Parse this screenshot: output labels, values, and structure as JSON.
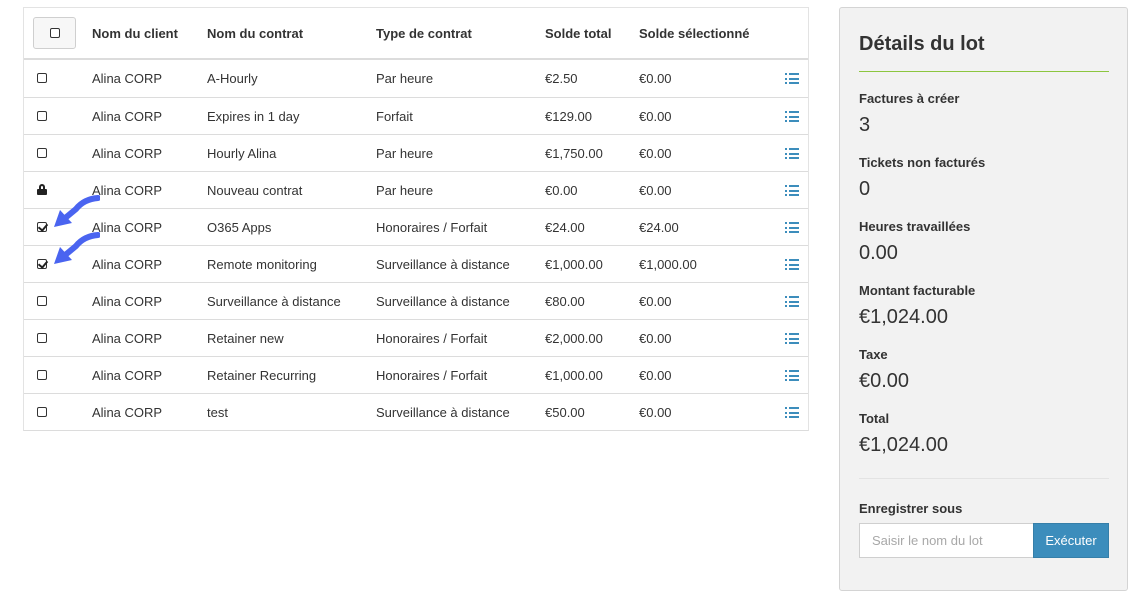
{
  "table": {
    "headers": {
      "client": "Nom du client",
      "contract": "Nom du contrat",
      "type": "Type de contrat",
      "total": "Solde total",
      "selected": "Solde sélectionné"
    },
    "rows": [
      {
        "state": "unchecked",
        "client": "Alina CORP",
        "contract": "A-Hourly",
        "type": "Par heure",
        "total": "€2.50",
        "selected": "€0.00"
      },
      {
        "state": "unchecked",
        "client": "Alina CORP",
        "contract": "Expires in 1 day",
        "type": "Forfait",
        "total": "€129.00",
        "selected": "€0.00"
      },
      {
        "state": "unchecked",
        "client": "Alina CORP",
        "contract": "Hourly Alina",
        "type": "Par heure",
        "total": "€1,750.00",
        "selected": "€0.00"
      },
      {
        "state": "locked",
        "client": "Alina CORP",
        "contract": "Nouveau contrat",
        "type": "Par heure",
        "total": "€0.00",
        "selected": "€0.00"
      },
      {
        "state": "checked",
        "client": "Alina CORP",
        "contract": "O365 Apps",
        "type": "Honoraires / Forfait",
        "total": "€24.00",
        "selected": "€24.00"
      },
      {
        "state": "checked",
        "client": "Alina CORP",
        "contract": "Remote monitoring",
        "type": "Surveillance à distance",
        "total": "€1,000.00",
        "selected": "€1,000.00"
      },
      {
        "state": "unchecked",
        "client": "Alina CORP",
        "contract": "Surveillance à distance",
        "type": "Surveillance à distance",
        "total": "€80.00",
        "selected": "€0.00"
      },
      {
        "state": "unchecked",
        "client": "Alina CORP",
        "contract": "Retainer new",
        "type": "Honoraires / Forfait",
        "total": "€2,000.00",
        "selected": "€0.00"
      },
      {
        "state": "unchecked",
        "client": "Alina CORP",
        "contract": "Retainer Recurring",
        "type": "Honoraires / Forfait",
        "total": "€1,000.00",
        "selected": "€0.00"
      },
      {
        "state": "unchecked",
        "client": "Alina CORP",
        "contract": "test",
        "type": "Surveillance à distance",
        "total": "€50.00",
        "selected": "€0.00"
      }
    ]
  },
  "panel": {
    "title": "Détails du lot",
    "stats": [
      {
        "label": "Factures à créer",
        "value": "3"
      },
      {
        "label": "Tickets non facturés",
        "value": "0"
      },
      {
        "label": "Heures travaillées",
        "value": "0.00"
      },
      {
        "label": "Montant facturable",
        "value": "€1,024.00"
      },
      {
        "label": "Taxe",
        "value": "€0.00"
      },
      {
        "label": "Total",
        "value": "€1,024.00"
      }
    ],
    "save_label": "Enregistrer sous",
    "input_placeholder": "Saisir le nom du lot",
    "run_label": "Exécuter"
  },
  "colors": {
    "accent": "#3c8dbc",
    "rule": "#8cc63f",
    "annotation_arrow": "#4a64f0"
  },
  "icons": {
    "row_action": "list-icon",
    "locked_row": "lock-icon",
    "annotation": "arrow-icon"
  }
}
